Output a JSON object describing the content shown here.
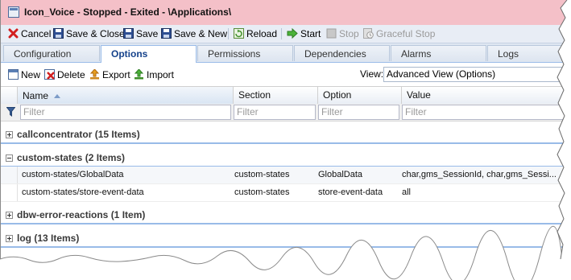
{
  "window": {
    "title": "Icon_Voice - Stopped - Exited - \\Applications\\"
  },
  "toolbar": {
    "cancel": "Cancel",
    "save_close": "Save & Close",
    "save": "Save",
    "save_new": "Save & New",
    "reload": "Reload",
    "start": "Start",
    "stop": "Stop",
    "graceful_stop": "Graceful Stop"
  },
  "tabs": [
    "Configuration",
    "Options",
    "Permissions",
    "Dependencies",
    "Alarms",
    "Logs"
  ],
  "active_tab": "Options",
  "subtoolbar": {
    "new": "New",
    "delete": "Delete",
    "export": "Export",
    "import": "Import",
    "view_label": "View:",
    "view_value": "Advanced View (Options)"
  },
  "grid": {
    "columns": [
      "Name",
      "Section",
      "Option",
      "Value"
    ],
    "filter_placeholder": "Filter",
    "groups": [
      {
        "label": "callconcentrator (15 Items)",
        "expanded": false,
        "rows": []
      },
      {
        "label": "custom-states (2 Items)",
        "expanded": true,
        "rows": [
          {
            "name": "custom-states/GlobalData",
            "section": "custom-states",
            "option": "GlobalData",
            "value": "char,gms_SessionId, char,gms_Sessi..."
          },
          {
            "name": "custom-states/store-event-data",
            "section": "custom-states",
            "option": "store-event-data",
            "value": "all"
          }
        ]
      },
      {
        "label": "dbw-error-reactions (1 Item)",
        "expanded": false,
        "rows": []
      },
      {
        "label": "log (13 Items)",
        "expanded": false,
        "rows": []
      }
    ]
  }
}
